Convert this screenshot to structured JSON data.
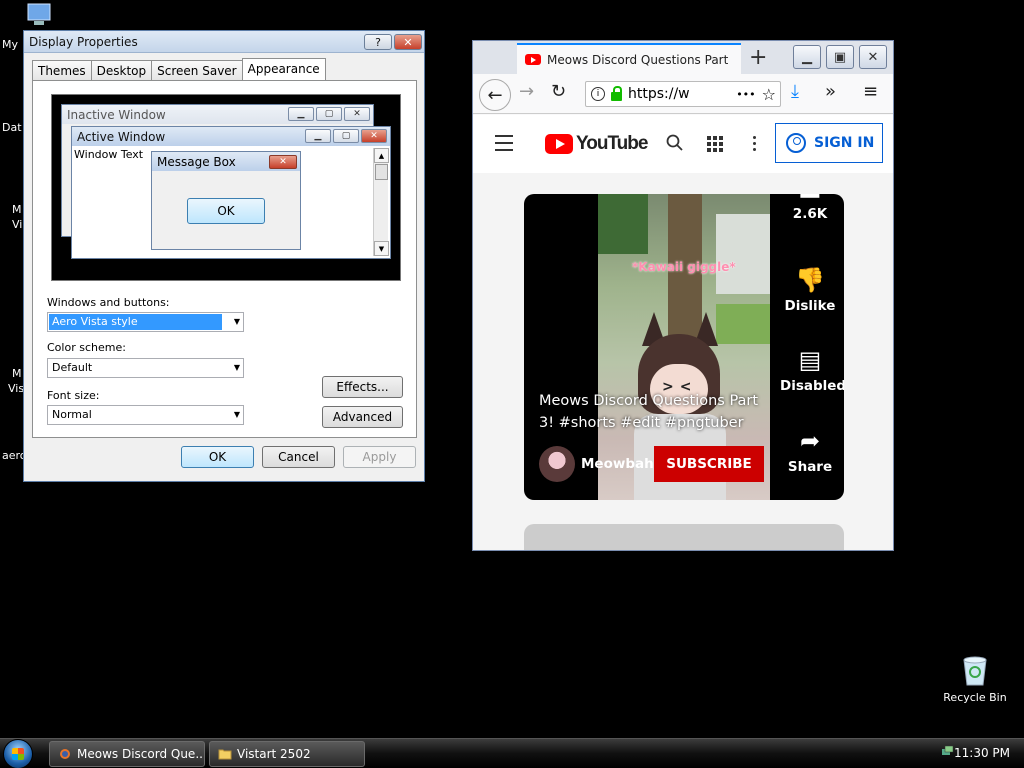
{
  "desktop": {
    "left_labels": [
      "My",
      "Dat",
      "M",
      "Vi",
      "M",
      "Vis",
      "aero"
    ],
    "recycle_label": "Recycle Bin"
  },
  "display_props": {
    "title": "Display Properties",
    "help_label": "?",
    "tabs": [
      "Themes",
      "Desktop",
      "Screen Saver",
      "Appearance"
    ],
    "active_tab": "Appearance",
    "preview": {
      "inactive_title": "Inactive Window",
      "active_title": "Active Window",
      "window_text": "Window Text",
      "msgbox_title": "Message Box",
      "msgbox_ok": "OK"
    },
    "windows_buttons_label": "Windows and buttons:",
    "windows_buttons_value": "Aero Vista style",
    "color_scheme_label": "Color scheme:",
    "color_scheme_value": "Default",
    "font_size_label": "Font size:",
    "font_size_value": "Normal",
    "effects_label": "Effects...",
    "advanced_label": "Advanced",
    "ok_label": "OK",
    "cancel_label": "Cancel",
    "apply_label": "Apply"
  },
  "firefox": {
    "tab_title": "Meows Discord Questions Part",
    "new_tab": "+",
    "url": "https://w",
    "url_more": "•••",
    "overflow": "»",
    "menu": "≡"
  },
  "youtube": {
    "logo_text": "YouTube",
    "signin_label": "SIGN IN",
    "short": {
      "overlay_text": "*Kawaii giggle*",
      "title": "Meows Discord Questions Part 3! #shorts #edit #pngtuber",
      "channel": "Meowbahh",
      "subscribe": "SUBSCRIBE",
      "likes": "2.6K",
      "dislike_label": "Dislike",
      "comments_label": "Disabled",
      "share_label": "Share"
    }
  },
  "taskbar": {
    "tasks": [
      {
        "label": "Meows Discord Que..."
      },
      {
        "label": "Vistart 2502"
      }
    ],
    "clock": "11:30 PM"
  }
}
